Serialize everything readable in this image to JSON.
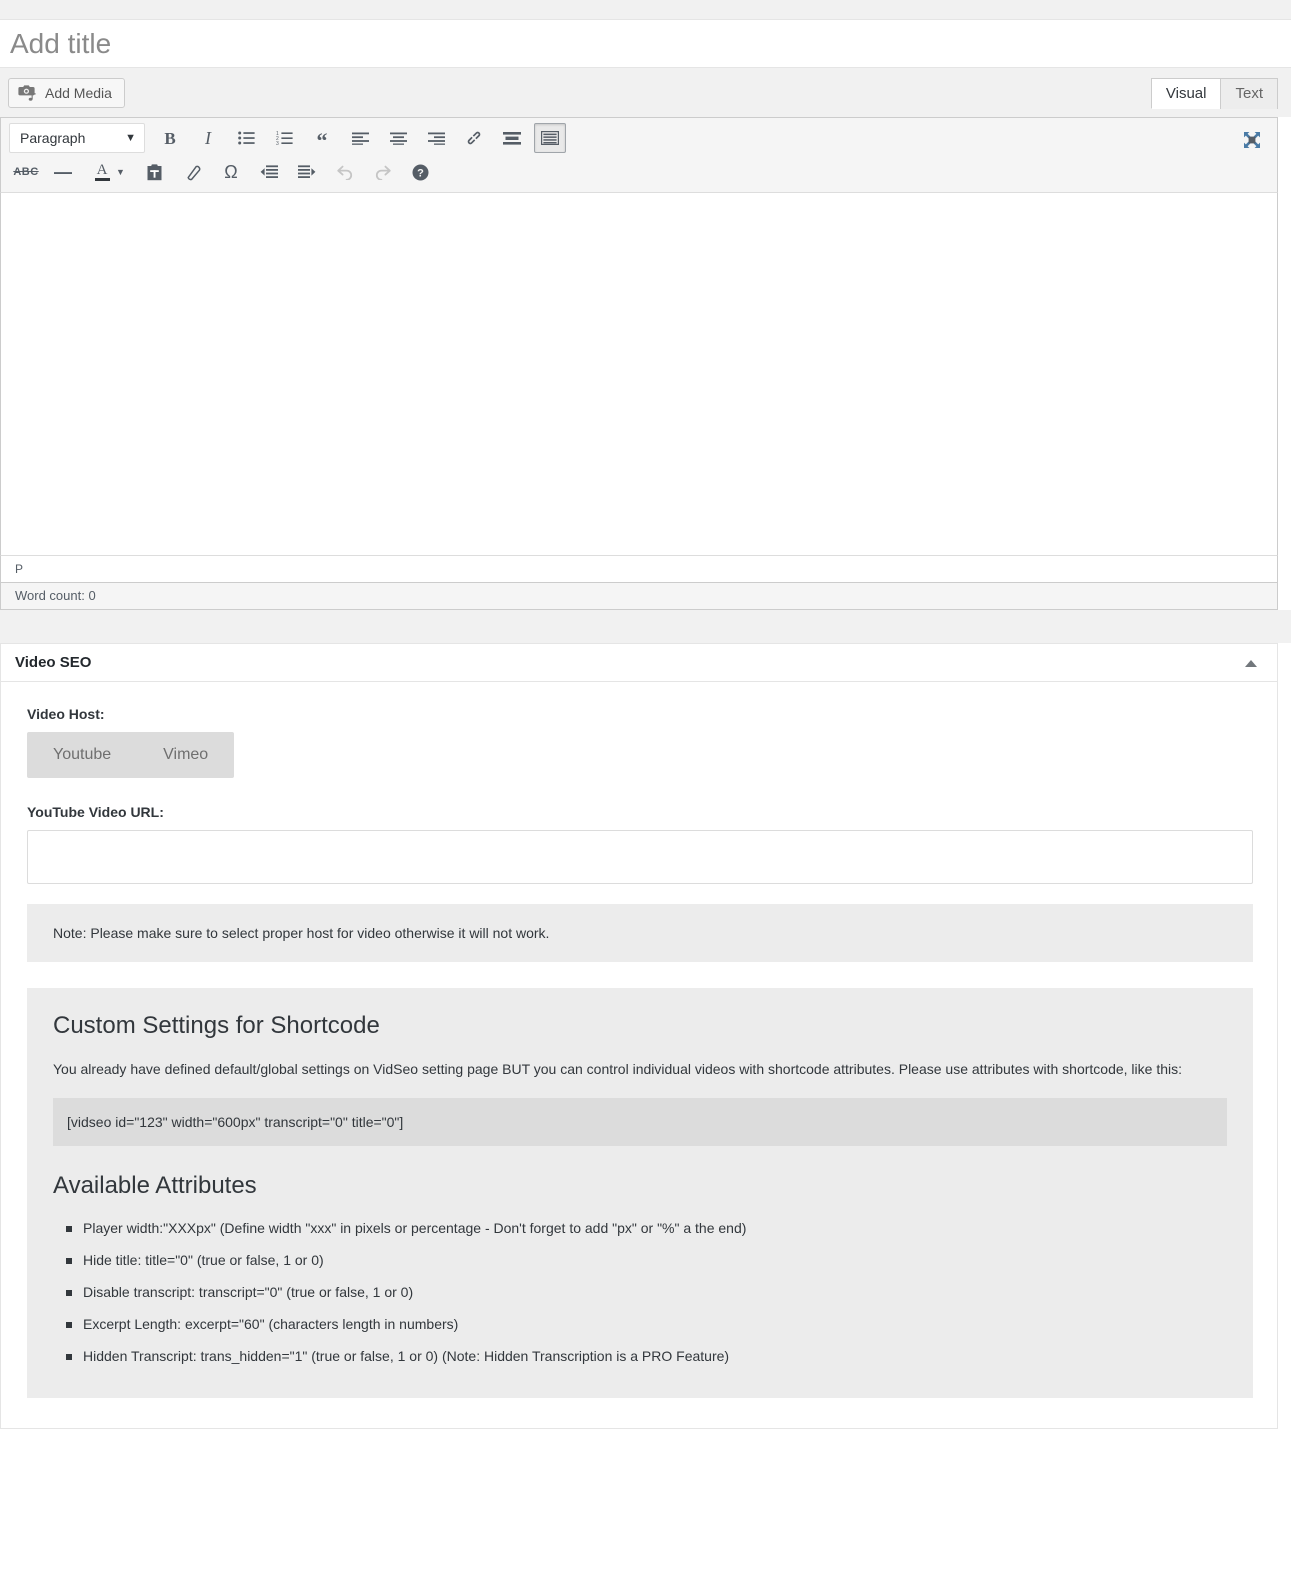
{
  "title": {
    "placeholder": "Add title",
    "value": ""
  },
  "media_bar": {
    "add_media_label": "Add Media",
    "add_media_icon": "camera-music-icon"
  },
  "editor_tabs": [
    {
      "label": "Visual",
      "active": true
    },
    {
      "label": "Text",
      "active": false
    }
  ],
  "toolbar": {
    "format_select": {
      "value": "Paragraph",
      "caret_icon": "chevron-down-icon"
    },
    "row1": [
      {
        "name": "bold",
        "glyph": "B",
        "title": "Bold"
      },
      {
        "name": "italic",
        "glyph": "I",
        "title": "Italic"
      },
      {
        "name": "bullet-list",
        "glyph": "",
        "title": "Bulleted list"
      },
      {
        "name": "numbered-list",
        "glyph": "",
        "title": "Numbered list"
      },
      {
        "name": "blockquote",
        "glyph": "“",
        "title": "Blockquote"
      },
      {
        "name": "align-left",
        "glyph": "",
        "title": "Align left"
      },
      {
        "name": "align-center",
        "glyph": "",
        "title": "Align center"
      },
      {
        "name": "align-right",
        "glyph": "",
        "title": "Align right"
      },
      {
        "name": "insert-link",
        "glyph": "",
        "title": "Insert/edit link"
      },
      {
        "name": "read-more",
        "glyph": "",
        "title": "Insert Read More tag"
      },
      {
        "name": "toolbar-toggle",
        "glyph": "",
        "title": "Toolbar Toggle",
        "pressed": true
      }
    ],
    "row2": [
      {
        "name": "strikethrough",
        "glyph": "ABC",
        "title": "Strikethrough"
      },
      {
        "name": "horizontal-line",
        "glyph": "—",
        "title": "Horizontal line"
      },
      {
        "name": "text-color",
        "glyph": "A",
        "title": "Text color"
      },
      {
        "name": "text-color-caret",
        "glyph": "▼",
        "title": "Text color options"
      },
      {
        "name": "paste-as-text",
        "glyph": "",
        "title": "Paste as text"
      },
      {
        "name": "clear-formatting",
        "glyph": "",
        "title": "Clear formatting"
      },
      {
        "name": "special-character",
        "glyph": "Ω",
        "title": "Special character"
      },
      {
        "name": "decrease-indent",
        "glyph": "",
        "title": "Decrease indent"
      },
      {
        "name": "increase-indent",
        "glyph": "",
        "title": "Increase indent"
      },
      {
        "name": "undo",
        "glyph": "",
        "title": "Undo",
        "disabled": true
      },
      {
        "name": "redo",
        "glyph": "",
        "title": "Redo",
        "disabled": true
      },
      {
        "name": "keyboard-shortcuts",
        "glyph": "?",
        "title": "Keyboard Shortcuts"
      }
    ],
    "fullscreen_icon": "fullscreen-expand-icon"
  },
  "status_bar": {
    "element_path": "P",
    "word_count": "Word count: 0"
  },
  "metabox": {
    "title": "Video SEO",
    "toggle_icon": "triangle-up-icon",
    "video_host_label": "Video Host:",
    "hosts": [
      {
        "label": "Youtube"
      },
      {
        "label": "Vimeo"
      }
    ],
    "url_label": "YouTube Video URL:",
    "url_value": "",
    "url_placeholder": "",
    "note": "Note: Please make sure to select proper host for video otherwise it will not work."
  },
  "info": {
    "heading": "Custom Settings for Shortcode",
    "paragraph": "You already have defined default/global settings on VidSeo setting page BUT you can control individual videos with shortcode attributes. Please use attributes with shortcode, like this:",
    "code": "[vidseo id=\"123\" width=\"600px\" transcript=\"0\" title=\"0\"]",
    "attributes_heading": "Available Attributes",
    "attributes": [
      "Player width:\"XXXpx\" (Define width \"xxx\" in pixels or percentage - Don't forget to add \"px\" or \"%\" a the end)",
      "Hide title: title=\"0\" (true or false, 1 or 0)",
      "Disable transcript: transcript=\"0\" (true or false, 1 or 0)",
      "Excerpt Length: excerpt=\"60\" (characters length in numbers)",
      "Hidden Transcript: trans_hidden=\"1\" (true or false, 1 or 0) (Note: Hidden Transcription is a PRO Feature)"
    ]
  },
  "colors": {
    "page_bg": "#ffffff",
    "chrome_bg": "#f1f1f1",
    "toolbar_bg": "#f5f5f5",
    "panel_gray": "#ececec",
    "code_gray": "#dcdcdc",
    "border": "#e5e5e5",
    "text": "#32373c",
    "icon": "#555d66"
  }
}
